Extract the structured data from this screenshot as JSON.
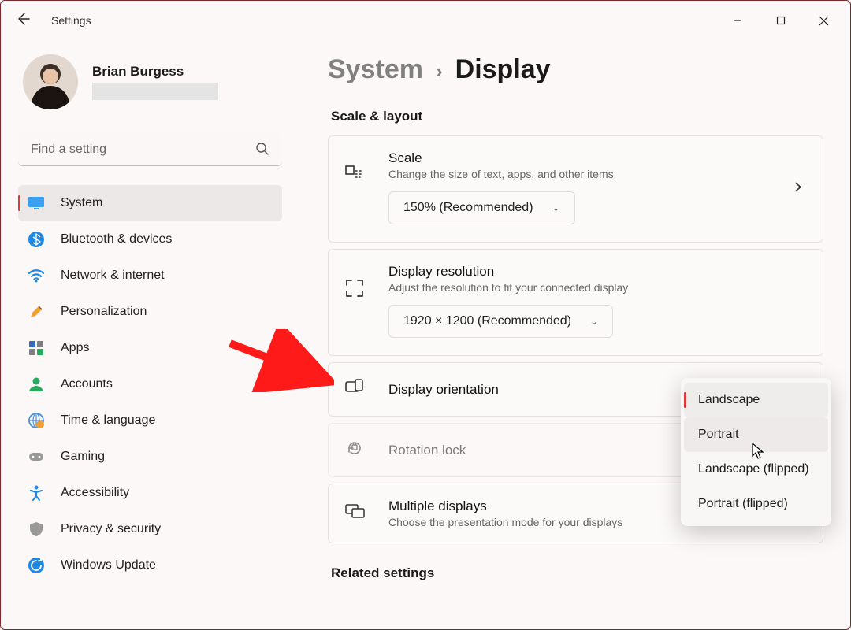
{
  "window": {
    "title": "Settings"
  },
  "user": {
    "name": "Brian Burgess"
  },
  "search": {
    "placeholder": "Find a setting"
  },
  "sidebar": {
    "items": [
      {
        "label": "System"
      },
      {
        "label": "Bluetooth & devices"
      },
      {
        "label": "Network & internet"
      },
      {
        "label": "Personalization"
      },
      {
        "label": "Apps"
      },
      {
        "label": "Accounts"
      },
      {
        "label": "Time & language"
      },
      {
        "label": "Gaming"
      },
      {
        "label": "Accessibility"
      },
      {
        "label": "Privacy & security"
      },
      {
        "label": "Windows Update"
      }
    ]
  },
  "breadcrumb": {
    "parent": "System",
    "current": "Display"
  },
  "section": {
    "scale_layout": "Scale & layout",
    "related": "Related settings"
  },
  "cards": {
    "scale": {
      "title": "Scale",
      "sub": "Change the size of text, apps, and other items",
      "selected": "150% (Recommended)"
    },
    "resolution": {
      "title": "Display resolution",
      "sub": "Adjust the resolution to fit your connected display",
      "selected": "1920 × 1200 (Recommended)"
    },
    "orientation": {
      "title": "Display orientation",
      "options": [
        "Landscape",
        "Portrait",
        "Landscape (flipped)",
        "Portrait (flipped)"
      ]
    },
    "rotation_lock": {
      "title": "Rotation lock"
    },
    "multiple": {
      "title": "Multiple displays",
      "sub": "Choose the presentation mode for your displays"
    }
  }
}
